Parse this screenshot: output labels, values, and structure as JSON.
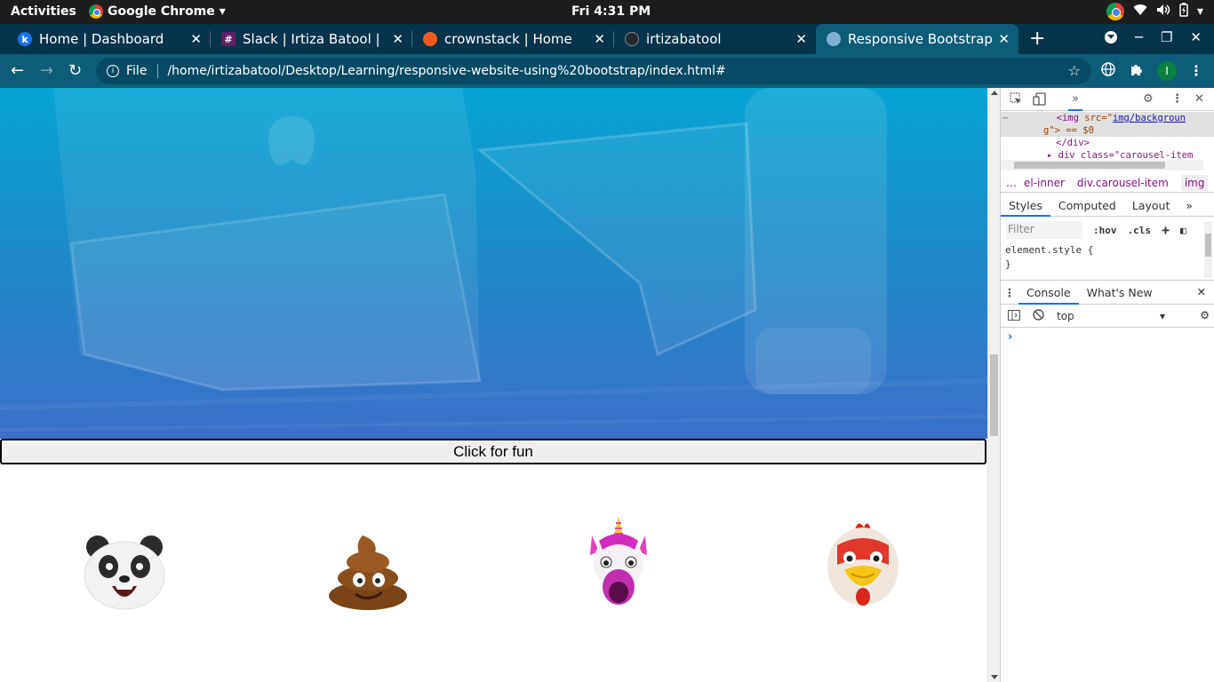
{
  "system_bar": {
    "activities": "Activities",
    "app_name": "Google Chrome",
    "clock": "Fri  4:31 PM"
  },
  "tabs": [
    {
      "title": "Home | Dashboard",
      "favicon_letter": "k",
      "favicon_color": "#1a73e8"
    },
    {
      "title": "Slack | Irtiza Batool | cro",
      "favicon_letter": "#",
      "favicon_color": "#611f69"
    },
    {
      "title": "crownstack | Home",
      "favicon_letter": "",
      "favicon_color": "#f05a22"
    },
    {
      "title": "irtizabatool",
      "favicon_letter": "",
      "favicon_color": "#24292e"
    },
    {
      "title": "Responsive Bootstrap W",
      "favicon_letter": "",
      "favicon_color": "#7fb0d6",
      "active": true
    }
  ],
  "toolbar": {
    "scheme_label": "File",
    "url": "/home/irtizabatool/Desktop/Learning/responsive-website-using%20bootstrap/index.html#",
    "profile_initial": "I"
  },
  "page": {
    "fun_button_label": "Click for fun",
    "emojis": [
      "panda",
      "poop",
      "unicorn",
      "chicken"
    ]
  },
  "devtools": {
    "dom_line1_tag": "<img",
    "dom_line1_attr": "src=\"",
    "dom_line1_link": "img/backgroun",
    "dom_line2": "g\"> == $0",
    "dom_line3": "</div>",
    "dom_line4": "▸ div class=\"carousel-item",
    "breadcrumbs": [
      "…",
      "el-inner",
      "div.carousel-item",
      "img",
      "…"
    ],
    "subtabs": [
      "Styles",
      "Computed",
      "Layout"
    ],
    "filter_placeholder": "Filter",
    "hov": ":hov",
    "cls": ".cls",
    "element_style_open": "element.style {",
    "element_style_close": "}",
    "drawer_tabs": [
      "Console",
      "What's New"
    ],
    "context": "top",
    "prompt": "›"
  }
}
